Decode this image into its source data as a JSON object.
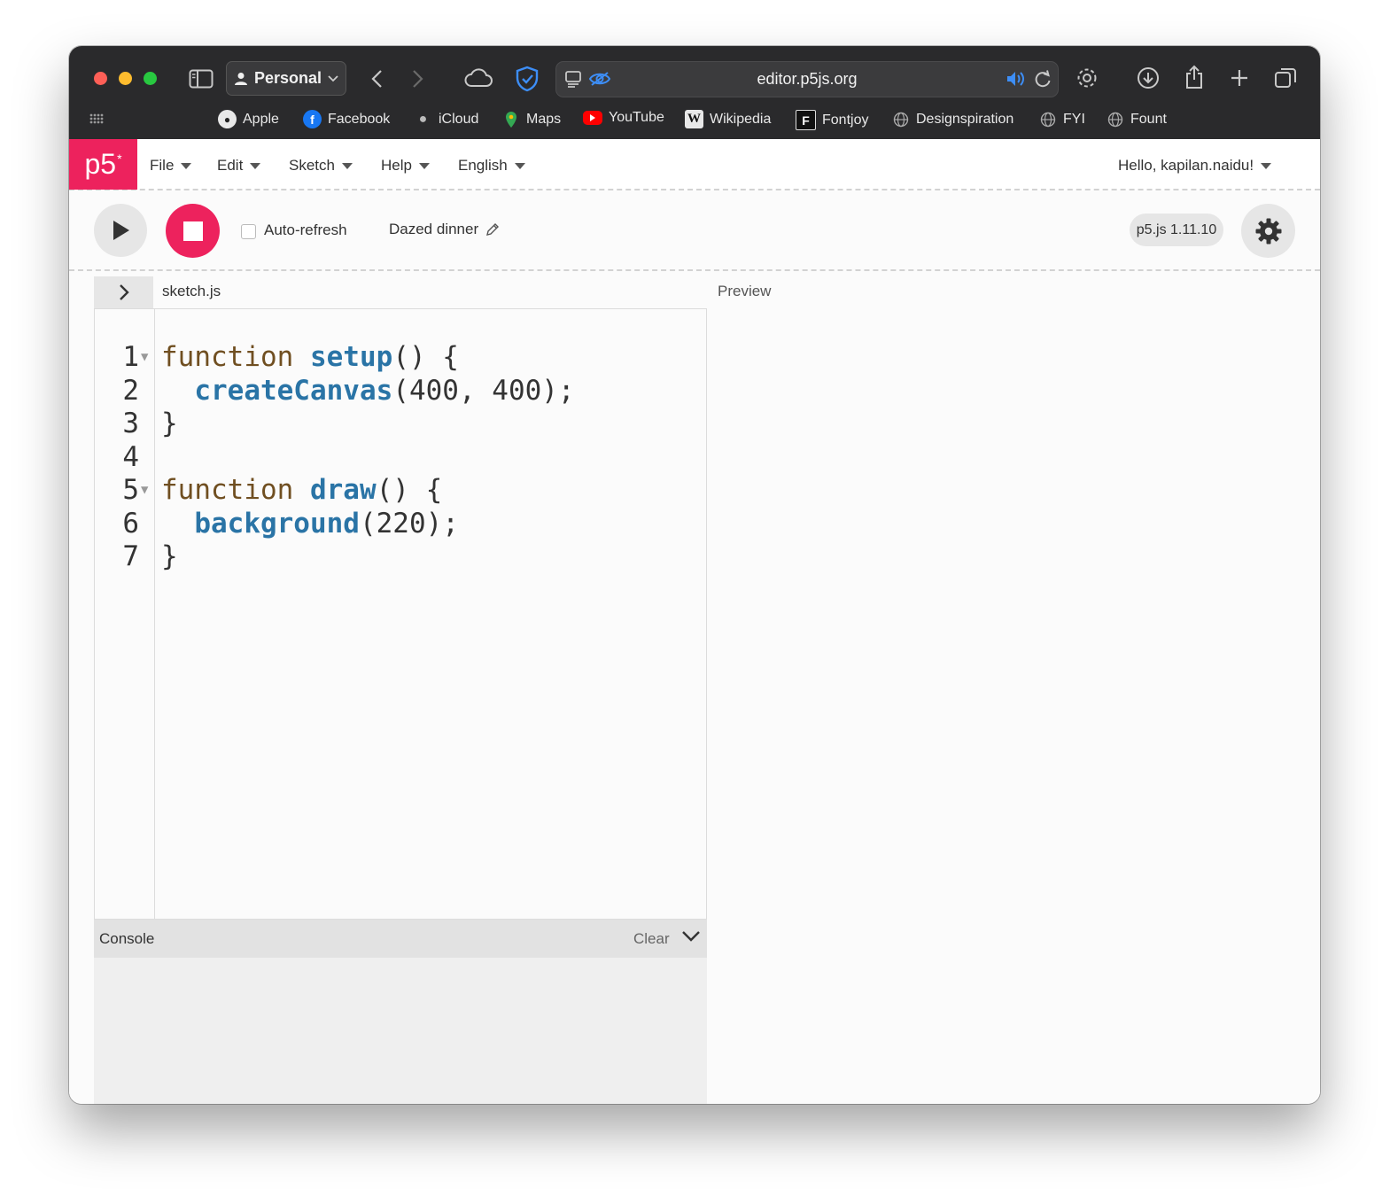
{
  "browser": {
    "profile_label": "Personal",
    "url": "editor.p5js.org",
    "bookmarks": [
      {
        "label": "Apple",
        "icon": "apple-icon"
      },
      {
        "label": "Facebook",
        "icon": "facebook-icon"
      },
      {
        "label": "iCloud",
        "icon": "apple-icon"
      },
      {
        "label": "Maps",
        "icon": "maps-pin-icon"
      },
      {
        "label": "YouTube",
        "icon": "youtube-icon"
      },
      {
        "label": "Wikipedia",
        "icon": "wikipedia-icon"
      },
      {
        "label": "Fontjoy",
        "icon": "fontjoy-icon"
      },
      {
        "label": "Designspiration",
        "icon": "globe-icon"
      },
      {
        "label": "FYI",
        "icon": "globe-icon"
      },
      {
        "label": "Fount",
        "icon": "globe-icon"
      }
    ]
  },
  "app": {
    "logo_text": "p5",
    "logo_sup": "*",
    "menu": {
      "file": "File",
      "edit": "Edit",
      "sketch": "Sketch",
      "help": "Help",
      "language": "English",
      "user": "Hello, kapilan.naidu!"
    },
    "toolbar": {
      "auto_refresh_label": "Auto-refresh",
      "auto_refresh_checked": false,
      "sketch_name": "Dazed dinner",
      "version": "p5.js 1.11.10"
    },
    "file_tab": "sketch.js",
    "preview_label": "Preview",
    "code_lines": [
      {
        "n": "1",
        "fold": true
      },
      {
        "n": "2",
        "fold": false
      },
      {
        "n": "3",
        "fold": false
      },
      {
        "n": "4",
        "fold": false
      },
      {
        "n": "5",
        "fold": true
      },
      {
        "n": "6",
        "fold": false
      },
      {
        "n": "7",
        "fold": false
      }
    ],
    "code": {
      "l1_kw": "function",
      "l1_fn": "setup",
      "l1_rest": "() {",
      "l2_fn": "createCanvas",
      "l2_rest": "(400, 400);",
      "l3": "}",
      "l5_kw": "function",
      "l5_fn": "draw",
      "l5_rest": "() {",
      "l6_fn": "background",
      "l6_rest": "(220);",
      "l7": "}"
    },
    "console": {
      "title": "Console",
      "clear_label": "Clear"
    }
  },
  "colors": {
    "p5_brand": "#ed225d",
    "keyword": "#704f21",
    "function": "#2a74a6"
  }
}
